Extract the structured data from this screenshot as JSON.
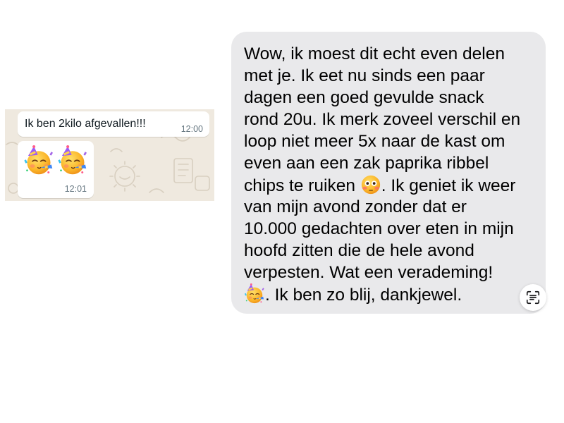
{
  "whatsapp_crop": {
    "messages": [
      {
        "text": "Ik ben 2kilo afgevallen!!!",
        "time": "12:00"
      },
      {
        "emojis": [
          "partying-face-emoji",
          "partying-face-emoji"
        ],
        "time": "12:01"
      }
    ],
    "background_color": "#efe9df",
    "bubble_color": "#ffffff"
  },
  "imessage": {
    "bubble_color": "#e9e9eb",
    "lines": [
      "Wow, ik moest dit echt even delen",
      "met je. Ik eet nu sinds een paar",
      "dagen een goed gevulde snack",
      "rond 20u. Ik merk zoveel verschil en",
      "loop niet meer 5x naar de kast om",
      "even aan een zak paprika ribbel"
    ],
    "line7_before": "chips te ruiken ",
    "line7_emoji": "flushed-face-emoji",
    "line7_after": ". Ik geniet ik weer",
    "line8": "van mijn avond zonder dat er",
    "line9": "10.000 gedachten over eten in mijn",
    "line10": "hoofd zitten die de hele avond",
    "line11": "verpesten. Wat een verademing!",
    "line12_emoji": "partying-face-emoji",
    "line12_after": ". Ik ben zo blij, dankjewel."
  },
  "live_text_button": {
    "icon": "text-scan-icon"
  }
}
